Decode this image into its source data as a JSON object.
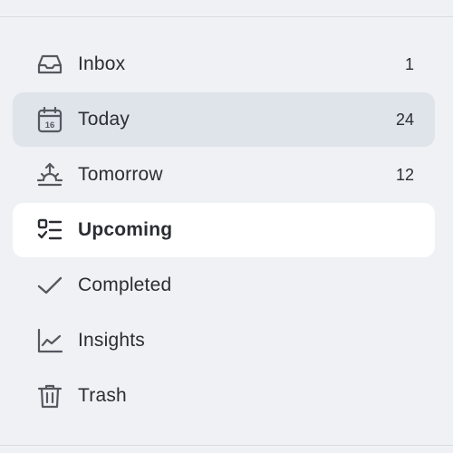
{
  "sidebar": {
    "items": [
      {
        "id": "inbox",
        "label": "Inbox",
        "count": "1",
        "icon": "inbox-icon",
        "state": "normal"
      },
      {
        "id": "today",
        "label": "Today",
        "count": "24",
        "icon": "calendar-today-icon",
        "calendar_day": "16",
        "state": "hovered"
      },
      {
        "id": "tomorrow",
        "label": "Tomorrow",
        "count": "12",
        "icon": "sunrise-icon",
        "state": "normal"
      },
      {
        "id": "upcoming",
        "label": "Upcoming",
        "count": "",
        "icon": "checklist-icon",
        "state": "selected"
      },
      {
        "id": "completed",
        "label": "Completed",
        "count": "",
        "icon": "checkmark-icon",
        "state": "normal"
      },
      {
        "id": "insights",
        "label": "Insights",
        "count": "",
        "icon": "line-chart-icon",
        "state": "normal"
      },
      {
        "id": "trash",
        "label": "Trash",
        "count": "",
        "icon": "trash-icon",
        "state": "normal"
      }
    ]
  },
  "colors": {
    "background": "#f0f1f5",
    "hover": "#dfe3ea",
    "selected": "#ffffff",
    "icon": "#55585f",
    "text": "#2b2d33"
  }
}
